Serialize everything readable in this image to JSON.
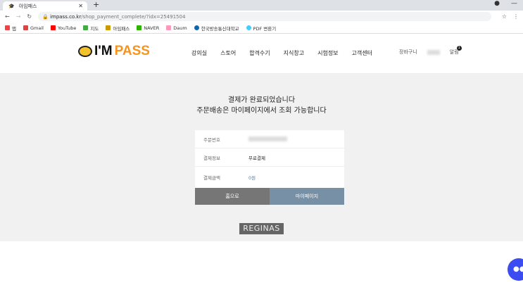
{
  "browser": {
    "tab_title": "아임패스",
    "url_host": "impass.co.kr",
    "url_path": "/shop_payment_complete/?idx=25491504",
    "bookmarks": [
      "앱",
      "Gmail",
      "YouTube",
      "지도",
      "아임패스",
      "NAVER",
      "Daum",
      "한국방송통신대학교",
      "PDF 변환기"
    ]
  },
  "header": {
    "logo_prefix": "I'M",
    "logo_suffix": "PASS",
    "nav": [
      "강의실",
      "스토어",
      "합격수기",
      "지식창고",
      "시험정보",
      "고객센터"
    ],
    "cart": "장바구니",
    "alarm": "알림",
    "alarm_count": "1"
  },
  "main": {
    "line1": "결제가 완료되었습니다",
    "line2": "주문배송은 마이페이지에서 조회 가능합니다",
    "rows": [
      {
        "label": "주문번호",
        "value": ""
      },
      {
        "label": "결제정보",
        "value": "무료결제"
      },
      {
        "label": "결제금액",
        "value": "0원"
      }
    ],
    "home_button": "홈으로",
    "mypage_button": "마이페이지",
    "footer_logo": "REGINAS"
  },
  "colors": {
    "accent": "#f7941d",
    "home_btn": "#767676",
    "mypage_btn": "#7890a6"
  }
}
